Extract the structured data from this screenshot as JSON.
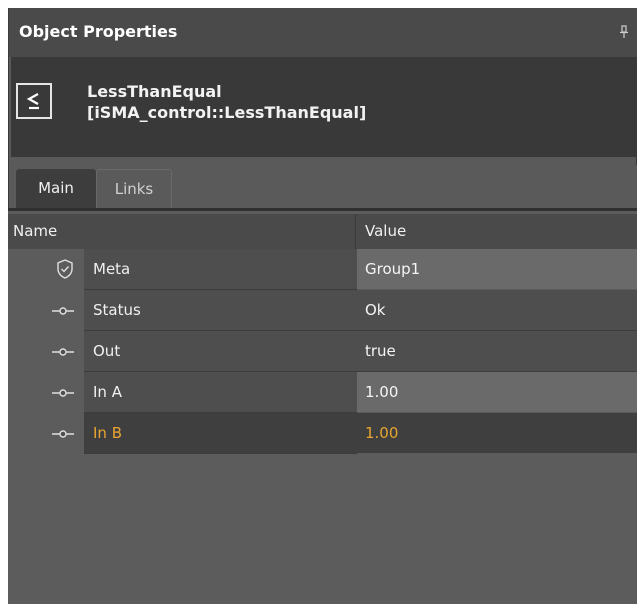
{
  "panel": {
    "title": "Object Properties",
    "pin_icon": "pin-icon"
  },
  "object": {
    "name": "LessThanEqual",
    "type": "[iSMA_control::LessThanEqual]",
    "icon_glyph": "≤",
    "icon": "less-than-equal-icon"
  },
  "tabs": [
    {
      "label": "Main",
      "active": true
    },
    {
      "label": "Links",
      "active": false
    }
  ],
  "grid": {
    "columns": {
      "name": "Name",
      "value": "Value"
    },
    "rows": [
      {
        "name": "Meta",
        "value": "Group1",
        "icon": "shield-check-icon"
      },
      {
        "name": "Status",
        "value": "Ok",
        "icon": "slot-icon"
      },
      {
        "name": "Out",
        "value": "true",
        "icon": "slot-icon"
      },
      {
        "name": "In A",
        "value": "1.00",
        "icon": "slot-icon"
      },
      {
        "name": "In B",
        "value": "1.00",
        "icon": "slot-icon",
        "selected": true
      }
    ]
  },
  "colors": {
    "highlight": "#e8a530"
  }
}
